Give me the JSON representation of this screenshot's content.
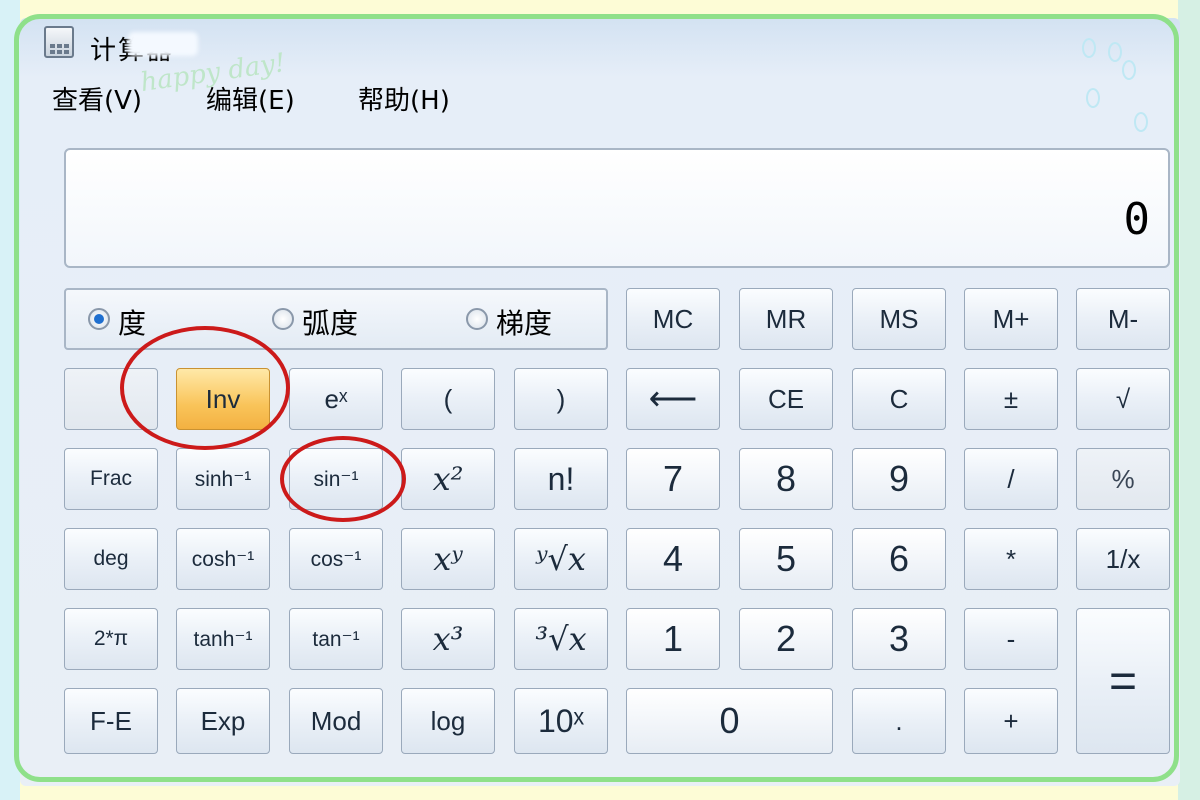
{
  "window": {
    "title": "计算器",
    "decoration_text": "happy day!"
  },
  "menu": [
    {
      "label": "查看(V)"
    },
    {
      "label": "编辑(E)"
    },
    {
      "label": "帮助(H)"
    }
  ],
  "display": {
    "value": "0"
  },
  "angle_units": {
    "selected": "度",
    "options": [
      "度",
      "弧度",
      "梯度"
    ]
  },
  "memory_buttons": [
    "MC",
    "MR",
    "MS",
    "M+",
    "M-"
  ],
  "row2": [
    "",
    "Inv",
    "eˣ",
    "(",
    ")",
    "⟵",
    "CE",
    "C",
    "±",
    "√"
  ],
  "row3": [
    "Frac",
    "sinh⁻¹",
    "sin⁻¹",
    "x²",
    "n!",
    "7",
    "8",
    "9",
    "/",
    "%"
  ],
  "row4": [
    "deg",
    "cosh⁻¹",
    "cos⁻¹",
    "xʸ",
    "ʸ√x",
    "4",
    "5",
    "6",
    "*",
    "1/x"
  ],
  "row5": [
    "2*π",
    "tanh⁻¹",
    "tan⁻¹",
    "x³",
    "³√x",
    "1",
    "2",
    "3",
    "-"
  ],
  "row6": [
    "F-E",
    "Exp",
    "Mod",
    "log",
    "10ˣ",
    "0",
    ".",
    "+"
  ],
  "equals": "=",
  "colors": {
    "accent_active": "#f9c45a",
    "annotation": "#cc1a1a",
    "frame": "#8fe08a"
  }
}
